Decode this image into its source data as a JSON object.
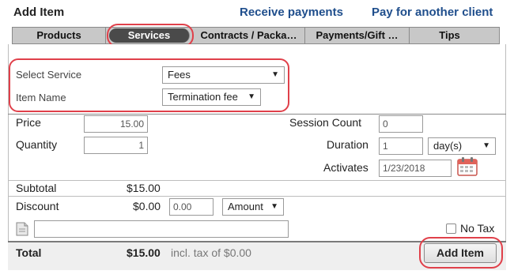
{
  "header": {
    "title": "Add Item",
    "links": [
      "Receive payments",
      "Pay for another client"
    ]
  },
  "tabs": [
    {
      "label": "Products",
      "active": false
    },
    {
      "label": "Services",
      "active": true
    },
    {
      "label": "Contracts / Packa…",
      "active": false
    },
    {
      "label": "Payments/Gift …",
      "active": false
    },
    {
      "label": "Tips",
      "active": false
    }
  ],
  "service": {
    "select_service_label": "Select Service",
    "select_service_value": "Fees",
    "item_name_label": "Item Name",
    "item_name_value": "Termination fee"
  },
  "details": {
    "price_label": "Price",
    "price_value": "15.00",
    "quantity_label": "Quantity",
    "quantity_value": "1",
    "session_count_label": "Session Count",
    "session_count_value": "0",
    "duration_label": "Duration",
    "duration_value": "1",
    "duration_unit": "day(s)",
    "activates_label": "Activates",
    "activates_value": "1/23/2018"
  },
  "summary": {
    "subtotal_label": "Subtotal",
    "subtotal_value": "$15.00",
    "discount_label": "Discount",
    "discount_amount": "$0.00",
    "discount_input": "0.00",
    "discount_type": "Amount",
    "notes_value": "",
    "no_tax_label": "No Tax"
  },
  "footer": {
    "total_label": "Total",
    "total_value": "$15.00",
    "tax_note": "incl. tax of $0.00",
    "add_item_label": "Add Item"
  },
  "colors": {
    "link": "#1f4e8c",
    "highlight": "#e0404a",
    "active_tab": "#4a4a4a",
    "tab_bar": "#c8c8c8"
  }
}
